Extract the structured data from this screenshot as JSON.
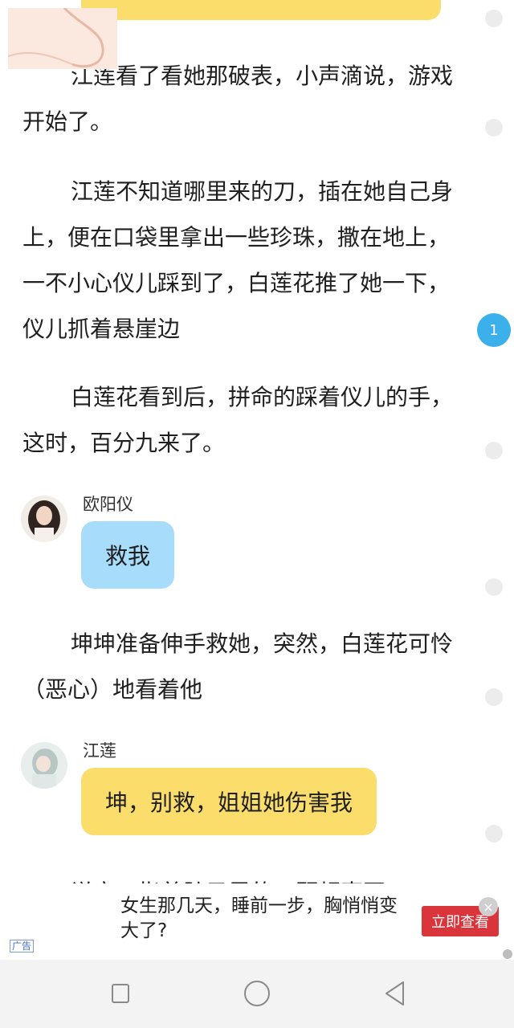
{
  "story": {
    "paragraphs": [
      "江莲看了看她那破表，小声滴说，游戏开始了。",
      "江莲不知道哪里来的刀，插在她自己身上，便在口袋里拿出一些珍珠，撒在地上，一不小心仪儿踩到了，白莲花推了她一下，仪儿抓着悬崖边",
      "白莲花看到后，拼命的踩着仪儿的手，这时，百分九来了。",
      "坤坤准备伸手救她，突然，白莲花可怜（恶心）地看着他"
    ],
    "dialogs": [
      {
        "speaker": "欧阳仪",
        "text": "救我",
        "color": "#a8dcfb"
      },
      {
        "speaker": "江莲",
        "text": "坤，别救，姐姐她伤害我",
        "color": "#fbdd6b"
      }
    ],
    "cut_off_text": "说完，指着肚子里的一颗超声豆"
  },
  "comment_badge": {
    "count": "1"
  },
  "ad": {
    "tag": "广告",
    "text": "女生那几天，睡前一步，胸悄悄变大了?",
    "button": "立即查看",
    "close": "×"
  },
  "navbar": {
    "icons": [
      "recent-apps-icon",
      "home-icon",
      "back-icon"
    ]
  },
  "colors": {
    "yellow_bubble": "#fbdd6b",
    "blue_bubble": "#a8dcfb",
    "badge": "#3cb0ea",
    "ad_button": "#d9353a"
  }
}
